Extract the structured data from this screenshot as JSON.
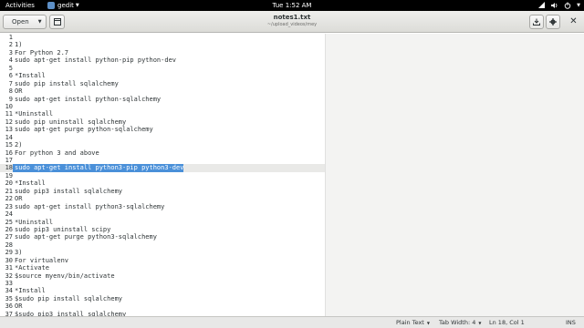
{
  "topbar": {
    "activities": "Activities",
    "app_name": "gedit",
    "clock": "Tue  1:52 AM"
  },
  "header": {
    "open_label": "Open",
    "title": "notes1.txt",
    "subtitle": "~/upload_videos/mey"
  },
  "editor": {
    "lines": [
      {
        "n": "1",
        "t": ""
      },
      {
        "n": "2",
        "t": "1)"
      },
      {
        "n": "3",
        "t": "For Python 2.7"
      },
      {
        "n": "4",
        "t": "sudo apt-get install python-pip python-dev"
      },
      {
        "n": "5",
        "t": ""
      },
      {
        "n": "6",
        "t": "*Install"
      },
      {
        "n": "7",
        "t": "sudo pip install sqlalchemy"
      },
      {
        "n": "8",
        "t": "OR"
      },
      {
        "n": "9",
        "t": "sudo apt-get install python-sqlalchemy"
      },
      {
        "n": "10",
        "t": ""
      },
      {
        "n": "11",
        "t": "*Uninstall"
      },
      {
        "n": "12",
        "t": "sudo pip uninstall sqlalchemy"
      },
      {
        "n": "13",
        "t": "sudo apt-get purge python-sqlalchemy"
      },
      {
        "n": "14",
        "t": ""
      },
      {
        "n": "15",
        "t": "2)"
      },
      {
        "n": "16",
        "t": "For python 3 and above"
      },
      {
        "n": "17",
        "t": ""
      },
      {
        "n": "18",
        "t": "sudo apt-get install python3-pip python3-dev",
        "selected": true
      },
      {
        "n": "19",
        "t": ""
      },
      {
        "n": "20",
        "t": "*Install"
      },
      {
        "n": "21",
        "t": "sudo pip3 install sqlalchemy"
      },
      {
        "n": "22",
        "t": "OR"
      },
      {
        "n": "23",
        "t": "sudo apt-get install python3-sqlalchemy"
      },
      {
        "n": "24",
        "t": ""
      },
      {
        "n": "25",
        "t": "*Uninstall"
      },
      {
        "n": "26",
        "t": "sudo pip3 uninstall scipy"
      },
      {
        "n": "27",
        "t": "sudo apt-get purge python3-sqlalchemy"
      },
      {
        "n": "28",
        "t": ""
      },
      {
        "n": "29",
        "t": "3)"
      },
      {
        "n": "30",
        "t": "For virtualenv"
      },
      {
        "n": "31",
        "t": "*Activate"
      },
      {
        "n": "32",
        "t": "$source myenv/bin/activate"
      },
      {
        "n": "33",
        "t": ""
      },
      {
        "n": "34",
        "t": "*Install"
      },
      {
        "n": "35",
        "t": "$sudo pip install sqlalchemy"
      },
      {
        "n": "36",
        "t": "OR"
      },
      {
        "n": "37",
        "t": "$sudo pip3 install sqlalchemy"
      }
    ]
  },
  "status": {
    "language": "Plain Text",
    "tab_width": "Tab Width: 4",
    "position": "Ln 18, Col 1",
    "mode": "INS"
  },
  "colors": {
    "selection": "#4a90d9",
    "topbar": "#000000"
  }
}
